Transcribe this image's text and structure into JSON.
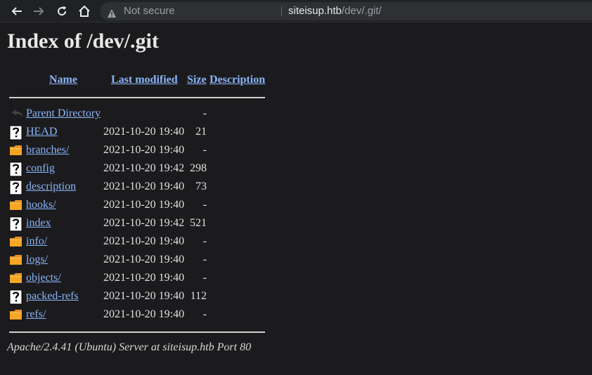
{
  "browser": {
    "security_label": "Not secure",
    "url_host": "siteisup.htb",
    "url_path": "/dev/.git/"
  },
  "page": {
    "title": "Index of /dev/.git",
    "columns": {
      "name": "Name",
      "last_modified": "Last modified",
      "size": "Size",
      "description": "Description"
    },
    "rows": [
      {
        "icon": "back-icon",
        "name": "Parent Directory",
        "date": "",
        "size": "-"
      },
      {
        "icon": "file-unknown-icon",
        "name": "HEAD",
        "date": "2021-10-20 19:40",
        "size": "21"
      },
      {
        "icon": "folder-icon",
        "name": "branches/",
        "date": "2021-10-20 19:40",
        "size": "-"
      },
      {
        "icon": "file-unknown-icon",
        "name": "config",
        "date": "2021-10-20 19:42",
        "size": "298"
      },
      {
        "icon": "file-unknown-icon",
        "name": "description",
        "date": "2021-10-20 19:40",
        "size": "73"
      },
      {
        "icon": "folder-icon",
        "name": "hooks/",
        "date": "2021-10-20 19:40",
        "size": "-"
      },
      {
        "icon": "file-unknown-icon",
        "name": "index",
        "date": "2021-10-20 19:42",
        "size": "521"
      },
      {
        "icon": "folder-icon",
        "name": "info/",
        "date": "2021-10-20 19:40",
        "size": "-"
      },
      {
        "icon": "folder-icon",
        "name": "logs/",
        "date": "2021-10-20 19:40",
        "size": "-"
      },
      {
        "icon": "folder-icon",
        "name": "objects/",
        "date": "2021-10-20 19:40",
        "size": "-"
      },
      {
        "icon": "file-unknown-icon",
        "name": "packed-refs",
        "date": "2021-10-20 19:40",
        "size": "112"
      },
      {
        "icon": "folder-icon",
        "name": "refs/",
        "date": "2021-10-20 19:40",
        "size": "-"
      }
    ],
    "footer": "Apache/2.4.41 (Ubuntu) Server at siteisup.htb Port 80"
  },
  "colors": {
    "background": "#1b1b1d",
    "link": "#8ab4f8",
    "folder": "#f5a623"
  }
}
